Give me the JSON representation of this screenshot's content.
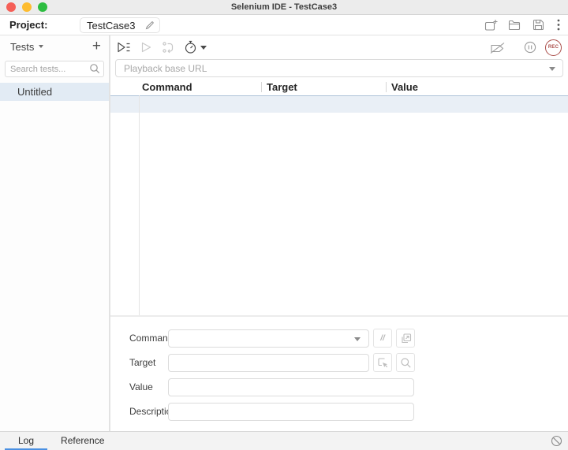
{
  "titlebar": {
    "title": "Selenium IDE - TestCase3"
  },
  "header": {
    "project_label": "Project:",
    "project_name": "TestCase3",
    "action_icons": [
      "new-project-icon",
      "open-project-icon",
      "save-project-icon",
      "more-menu-icon"
    ]
  },
  "sidebar": {
    "tests_label": "Tests",
    "add_test_label": "+",
    "search_placeholder": "Search tests...",
    "items": [
      {
        "label": "Untitled",
        "selected": true
      }
    ]
  },
  "toolbar": {
    "left_icons": [
      "run-all-tests-icon",
      "run-current-test-icon",
      "step-over-icon",
      "test-speed-icon"
    ],
    "right_icons": [
      "disable-breakpoints-icon",
      "pause-on-exceptions-icon",
      "record-button"
    ],
    "record_label": "REC"
  },
  "playback": {
    "base_url_placeholder": "Playback base URL"
  },
  "steps_table": {
    "columns": [
      "Command",
      "Target",
      "Value"
    ],
    "rows": [
      {
        "command": "",
        "target": "",
        "value": "",
        "selected": true
      }
    ]
  },
  "step_editor": {
    "command_label": "Command",
    "target_label": "Target",
    "value_label": "Value",
    "description_label": "Description",
    "command_value": "",
    "target_value": "",
    "value_value": "",
    "description_value": "",
    "command_buttons": [
      "toggle-comment-icon",
      "open-new-window-icon"
    ],
    "target_buttons": [
      "select-target-icon",
      "find-target-icon"
    ]
  },
  "footer": {
    "tabs": [
      {
        "label": "Log",
        "active": true
      },
      {
        "label": "Reference",
        "active": false
      }
    ],
    "right_icon": "clear-log-icon"
  },
  "colors": {
    "accent_blue": "#4a90e2",
    "record_red": "#ab4f4b",
    "selection_bg": "#e9eff6",
    "selection_border": "#aec3d8",
    "sidebar_selection_bg": "#e2ebf4",
    "traffic_red": "#f55f57",
    "traffic_yellow": "#fdbc2f",
    "traffic_green": "#2dbd41"
  }
}
